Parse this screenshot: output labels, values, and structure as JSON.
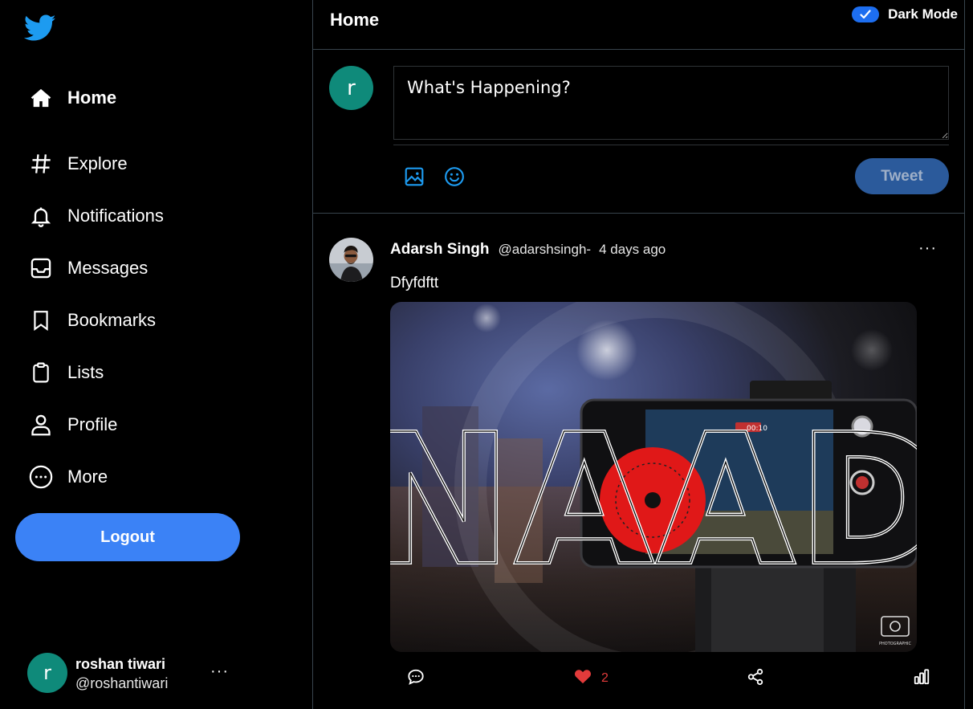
{
  "sidebar": {
    "logo": "twitter-bird-icon",
    "nav": [
      {
        "label": "Home",
        "icon": "home-icon",
        "active": true
      },
      {
        "label": "Explore",
        "icon": "hashtag-icon"
      },
      {
        "label": "Notifications",
        "icon": "bell-icon"
      },
      {
        "label": "Messages",
        "icon": "inbox-icon"
      },
      {
        "label": "Bookmarks",
        "icon": "bookmark-icon"
      },
      {
        "label": "Lists",
        "icon": "clipboard-icon"
      },
      {
        "label": "Profile",
        "icon": "user-icon"
      },
      {
        "label": "More",
        "icon": "more-circle-icon"
      }
    ],
    "logout_label": "Logout",
    "user": {
      "avatar_letter": "r",
      "name": "roshan tiwari",
      "handle": "@roshantiwari",
      "more": "···"
    }
  },
  "header": {
    "title": "Home",
    "dark_mode_label": "Dark Mode",
    "dark_mode_checked": true
  },
  "composer": {
    "avatar_letter": "r",
    "placeholder": "What's Happening?",
    "tweet_label": "Tweet"
  },
  "post": {
    "author": "Adarsh Singh",
    "handle": "@adarshsingh-",
    "time": "4 days ago",
    "more": "···",
    "text": "Dfyfdftt",
    "media_text": "NAAD",
    "media_timestamp": "00:10",
    "media_watermark": "PHOTOGRAPHIC",
    "like_count": "2"
  },
  "colors": {
    "accent": "#3b82f6",
    "tweet_btn": "#2b5a9b",
    "like": "#e23b3b",
    "icon_blue": "#1d9bf0",
    "avatar": "#0f8a7a",
    "border": "#38444d"
  }
}
